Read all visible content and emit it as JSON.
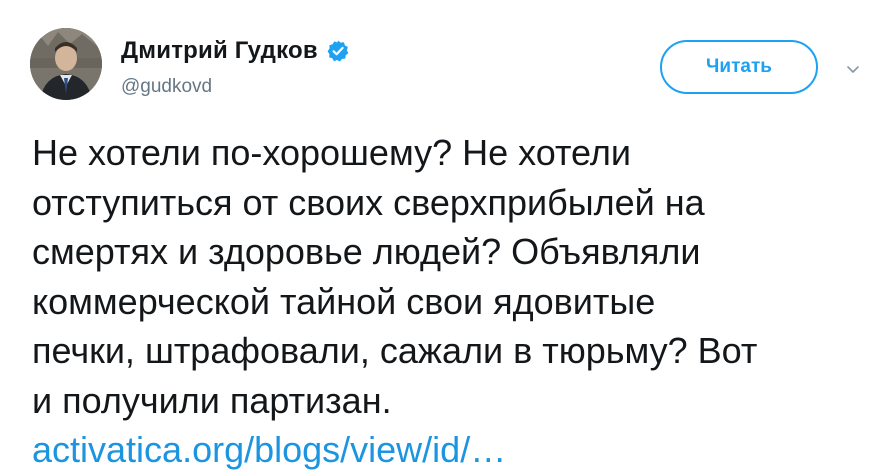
{
  "author": {
    "display_name": "Дмитрий Гудков",
    "handle": "@gudkovd",
    "verified": true,
    "verified_icon": "verified-badge-icon"
  },
  "actions": {
    "follow_label": "Читать",
    "menu_icon": "chevron-down-icon"
  },
  "tweet": {
    "lines": [
      "Не хотели по-хорошему? Не хотели",
      "отступиться от своих сверхприбылей на",
      "смертях и здоровье людей? Объявляли",
      "коммерческой тайной свои ядовитые",
      "печки, штрафовали, сажали в тюрьму? Вот",
      "и получили партизан."
    ],
    "link_text": "activatica.org/blogs/view/id/…"
  },
  "colors": {
    "accent": "#1da1f2",
    "link": "#1b95e0",
    "text": "#14171a",
    "muted": "#657786"
  }
}
